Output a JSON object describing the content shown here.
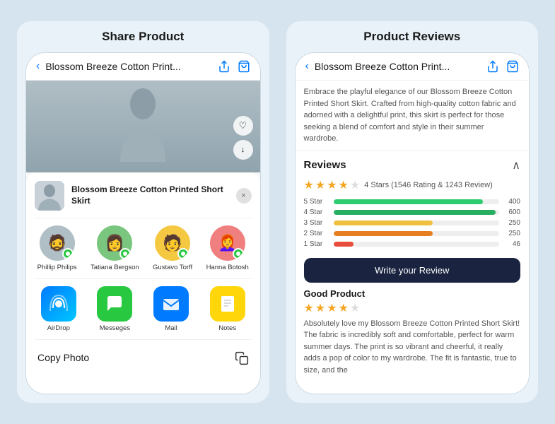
{
  "left_panel": {
    "title": "Share Product",
    "header": {
      "back": "‹",
      "page_title": "Blossom Breeze Cotton Print...",
      "share_icon": "share",
      "bag_icon": "bag"
    },
    "share_sheet": {
      "product_name": "Blossom Breeze Cotton Printed Short Skirt",
      "close_icon": "×",
      "contacts": [
        {
          "name": "Phillip Philips",
          "emoji": "🧔",
          "bg": "#c8d0d8"
        },
        {
          "name": "Tatiana Bergson",
          "emoji": "👩",
          "bg": "#7bc67e"
        },
        {
          "name": "Gustavo Torff",
          "emoji": "🧑",
          "bg": "#f5c842"
        },
        {
          "name": "Hanna Botosh",
          "emoji": "👩‍🦰",
          "bg": "#f08080"
        }
      ],
      "apps": [
        {
          "name": "AirDrop",
          "type": "airdrop"
        },
        {
          "name": "Messeges",
          "type": "messages"
        },
        {
          "name": "Mail",
          "type": "mail"
        },
        {
          "name": "Notes",
          "type": "notes"
        }
      ],
      "copy_label": "Copy Photo"
    }
  },
  "right_panel": {
    "title": "Product Reviews",
    "header": {
      "back": "‹",
      "page_title": "Blossom Breeze Cotton Print...",
      "share_icon": "share",
      "bag_icon": "bag"
    },
    "description": "Embrace the playful elegance of our Blossom Breeze Cotton Printed Short Skirt. Crafted from high-quality cotton fabric and adorned with a delightful print, this skirt is perfect for those seeking a blend of comfort and style in their summer wardrobe.",
    "reviews": {
      "section_title": "Reviews",
      "average_stars": 4,
      "rating_summary": "4 Stars (1546 Rating & 1243 Review)",
      "bars": [
        {
          "label": "5 Star",
          "percent": 90,
          "count": "400",
          "color": "#2ecc71"
        },
        {
          "label": "4 Star",
          "percent": 98,
          "count": "600",
          "color": "#27ae60"
        },
        {
          "label": "3 Star",
          "percent": 60,
          "count": "250",
          "color": "#f0c040"
        },
        {
          "label": "2 Star",
          "percent": 60,
          "count": "250",
          "color": "#e67e22"
        },
        {
          "label": "1 Star",
          "percent": 12,
          "count": "46",
          "color": "#e74c3c"
        }
      ],
      "write_review_label": "Write your Review",
      "featured_review": {
        "title": "Good Product",
        "stars": 4,
        "text": "Absolutely love my Blossom Breeze Cotton Printed Short Skirt! The fabric is incredibly soft and comfortable, perfect for warm summer days. The print is so vibrant and cheerful, it really adds a pop of color to my wardrobe. The fit is fantastic, true to size, and the"
      }
    }
  }
}
